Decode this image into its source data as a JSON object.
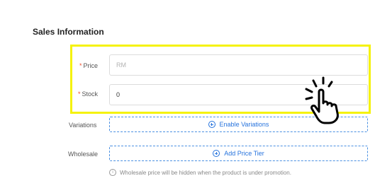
{
  "sales_info": {
    "title": "Sales Information"
  },
  "price": {
    "required_mark": "*",
    "label": "Price",
    "placeholder": "RM"
  },
  "stock": {
    "required_mark": "*",
    "label": "Stock",
    "value": "0"
  },
  "variations": {
    "label": "Variations",
    "button_label": "Enable Variations"
  },
  "wholesale": {
    "label": "Wholesale",
    "button_label": "Add Price Tier",
    "note": "Wholesale price will be hidden when the product is under promotion."
  },
  "colors": {
    "highlight": "#f5f20a",
    "accent": "#2673dd",
    "required": "#ee4d2d"
  },
  "icons": {
    "plus": "plus-circle-icon",
    "info": "info-icon",
    "pointer": "tap-hand-icon"
  }
}
